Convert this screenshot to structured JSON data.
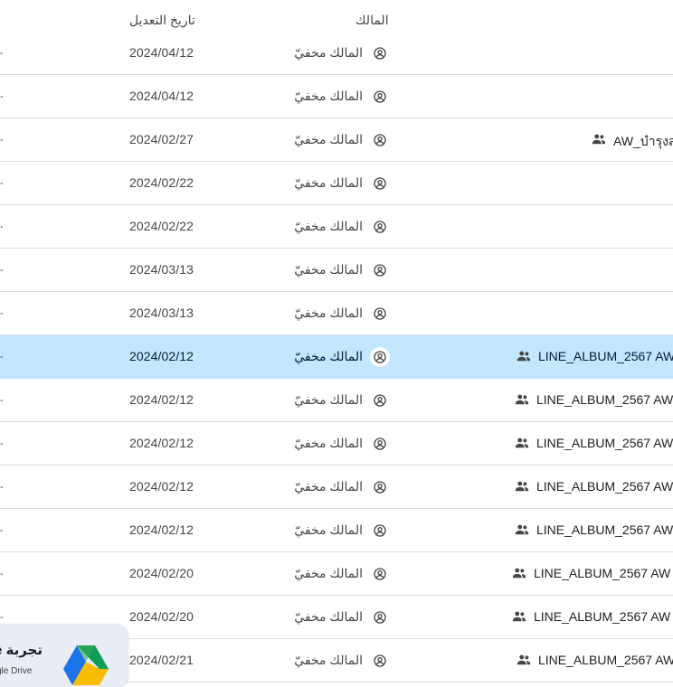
{
  "header": {
    "date_col": "تاريخ التعديل",
    "owner_col": "المالك"
  },
  "rows": [
    {
      "date": "2024/04/12",
      "owner": "المالك مخفيّ",
      "name": "",
      "shared": false,
      "selected": false
    },
    {
      "date": "2024/04/12",
      "owner": "المالك مخفيّ",
      "name": "",
      "shared": false,
      "selected": false
    },
    {
      "date": "2024/02/27",
      "owner": "المالك مخفيّ",
      "name": "AW_บำรุงส",
      "shared": true,
      "selected": false
    },
    {
      "date": "2024/02/22",
      "owner": "المالك مخفيّ",
      "name": "",
      "shared": false,
      "selected": false
    },
    {
      "date": "2024/02/22",
      "owner": "المالك مخفيّ",
      "name": "",
      "shared": false,
      "selected": false
    },
    {
      "date": "2024/03/13",
      "owner": "المالك مخفيّ",
      "name": "",
      "shared": false,
      "selected": false
    },
    {
      "date": "2024/03/13",
      "owner": "المالك مخفيّ",
      "name": "",
      "shared": false,
      "selected": false
    },
    {
      "date": "2024/02/12",
      "owner": "المالك مخفيّ",
      "name": "LINE_ALBUM_2567 AW",
      "shared": true,
      "selected": true
    },
    {
      "date": "2024/02/12",
      "owner": "المالك مخفيّ",
      "name": "LINE_ALBUM_2567 AW",
      "shared": true,
      "selected": false
    },
    {
      "date": "2024/02/12",
      "owner": "المالك مخفيّ",
      "name": "LINE_ALBUM_2567 AW",
      "shared": true,
      "selected": false
    },
    {
      "date": "2024/02/12",
      "owner": "المالك مخفيّ",
      "name": "LINE_ALBUM_2567 AW",
      "shared": true,
      "selected": false
    },
    {
      "date": "2024/02/12",
      "owner": "المالك مخفيّ",
      "name": "LINE_ALBUM_2567 AW",
      "shared": true,
      "selected": false
    },
    {
      "date": "2024/02/20",
      "owner": "المالك مخفيّ",
      "name": "LINE_ALBUM_2567 AW ،",
      "shared": true,
      "selected": false
    },
    {
      "date": "2024/02/20",
      "owner": "المالك مخفيّ",
      "name": "LINE_ALBUM_2567 AW ،",
      "shared": true,
      "selected": false
    },
    {
      "date": "2024/02/21",
      "owner": "المالك مخفيّ",
      "name": "LINE_ALBUM_2567 AW",
      "shared": true,
      "selected": false
    }
  ],
  "row_lead_glyph": "-",
  "promo": {
    "title": "تجربة e",
    "subtitle": "gle Drive"
  },
  "icons": {
    "owner": "account-circle-icon",
    "shared": "people-icon",
    "logo": "google-drive-logo-icon"
  },
  "colors": {
    "selected_row": "#c2e7ff",
    "divider": "#dadce0",
    "promo_bg": "#e9eef6"
  }
}
